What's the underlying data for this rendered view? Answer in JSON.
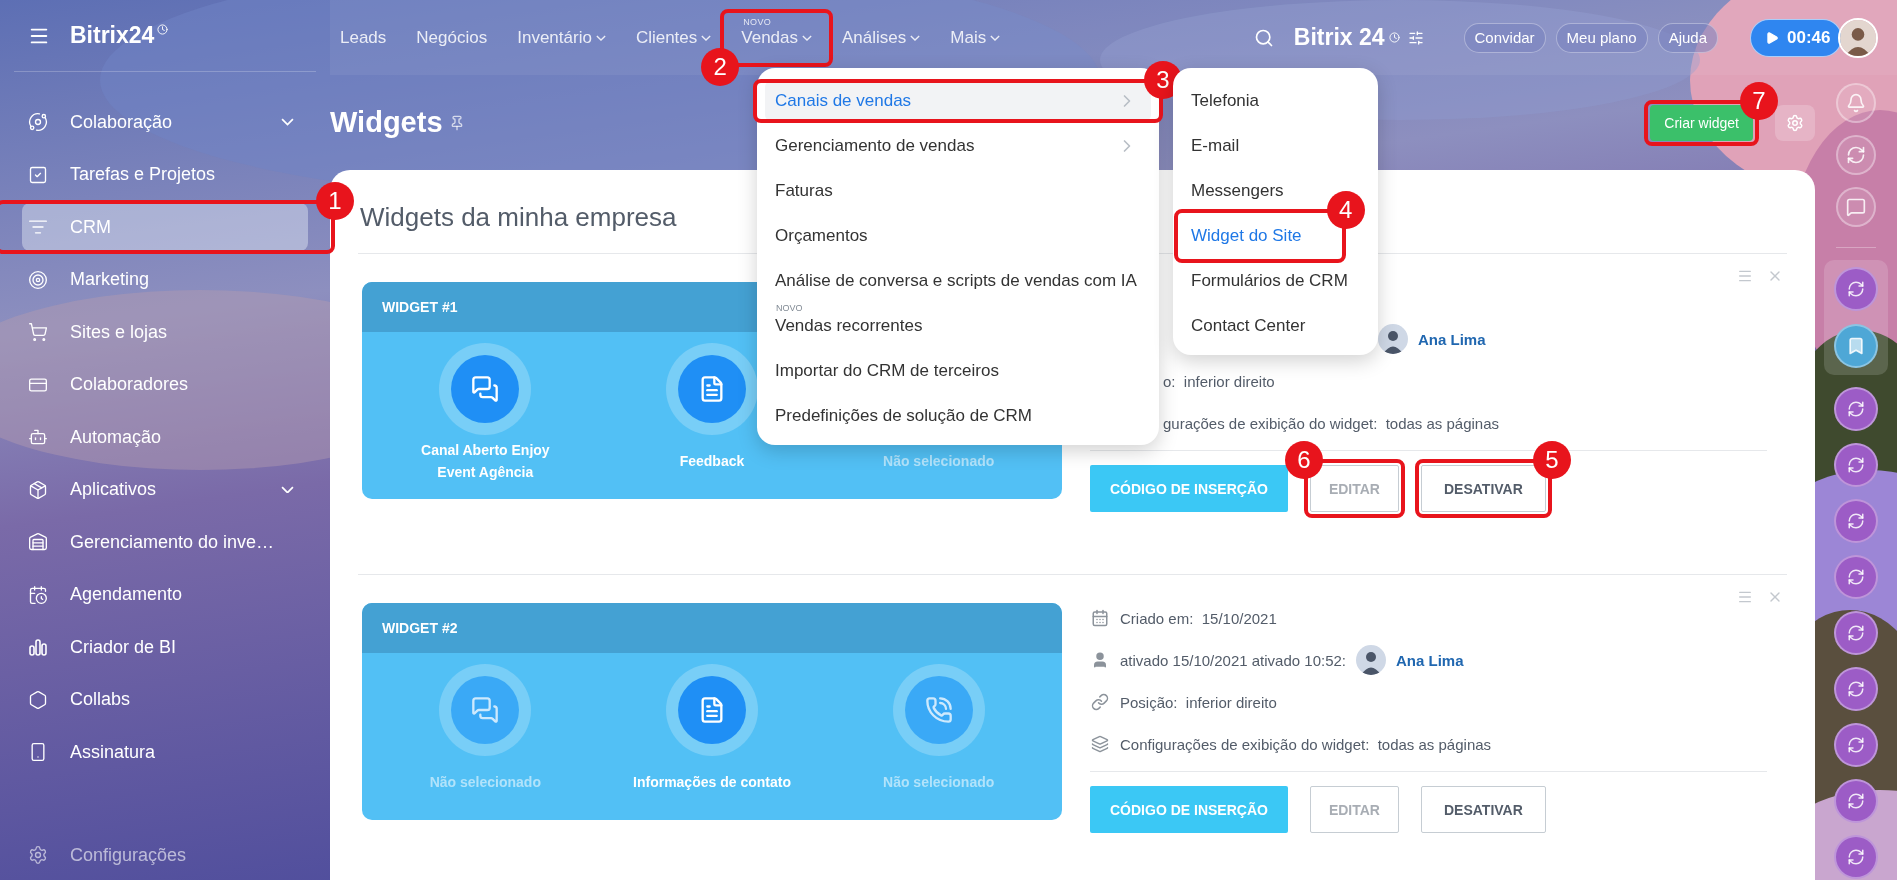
{
  "sidebar": {
    "logo": "Bitrix24",
    "items": [
      {
        "label": "Colaboração",
        "selected": false,
        "expandable": true
      },
      {
        "label": "Tarefas e Projetos",
        "selected": false,
        "expandable": false
      },
      {
        "label": "CRM",
        "selected": true,
        "expandable": false,
        "annotation": {
          "number": "1"
        }
      },
      {
        "label": "Marketing",
        "selected": false,
        "expandable": false
      },
      {
        "label": "Sites e lojas",
        "selected": false,
        "expandable": false
      },
      {
        "label": "Colaboradores",
        "selected": false,
        "expandable": false
      },
      {
        "label": "Automação",
        "selected": false,
        "expandable": false
      },
      {
        "label": "Aplicativos",
        "selected": false,
        "expandable": true
      },
      {
        "label": "Gerenciamento do inve…",
        "selected": false,
        "expandable": false
      },
      {
        "label": "Agendamento",
        "selected": false,
        "expandable": false
      },
      {
        "label": "Criador de BI",
        "selected": false,
        "expandable": false
      },
      {
        "label": "Collabs",
        "selected": false,
        "expandable": false
      },
      {
        "label": "Assinatura",
        "selected": false,
        "expandable": false
      }
    ],
    "footer": "Configurações"
  },
  "topbar": {
    "nav": [
      {
        "label": "Leads",
        "dropdown": false
      },
      {
        "label": "Negócios",
        "dropdown": false
      },
      {
        "label": "Inventário",
        "dropdown": true
      },
      {
        "label": "Clientes",
        "dropdown": true
      },
      {
        "label": "Vendas",
        "dropdown": true,
        "badge": "NOVO",
        "annotation": {
          "number": "2"
        }
      },
      {
        "label": "Análises",
        "dropdown": true
      },
      {
        "label": "Mais",
        "dropdown": true
      }
    ],
    "logo": "Bitrix 24",
    "buttons": [
      "Convidar",
      "Meu plano",
      "Ajuda"
    ],
    "timer": "00:46"
  },
  "page": {
    "title": "Widgets",
    "create_button": {
      "label": "Criar widget",
      "annotation": {
        "number": "7"
      }
    }
  },
  "card": {
    "title": "Widgets da minha empresa",
    "widgets": [
      {
        "header": "WIDGET #1",
        "under_menu": true,
        "items": [
          {
            "label": "Canal Aberto Enjoy Event Agência",
            "selected": true
          },
          {
            "label": "Feedback",
            "selected": true
          },
          {
            "label": "Não selecionado",
            "selected": false
          }
        ],
        "info": [
          {
            "person": "Ana Lima"
          },
          {
            "text": "o:  inferior direito"
          },
          {
            "text": "gurações de exibição do widget:  todas as páginas"
          }
        ],
        "buttons": [
          {
            "label": "CÓDIGO DE INSERÇÃO",
            "kind": "primary"
          },
          {
            "label": "EDITAR",
            "kind": "muted",
            "annotation": {
              "number": "6"
            }
          },
          {
            "label": "DESATIVAR",
            "kind": "outline",
            "annotation": {
              "number": "5"
            }
          }
        ]
      },
      {
        "header": "WIDGET #2",
        "under_menu": false,
        "items": [
          {
            "label": "Não selecionado",
            "selected": false
          },
          {
            "label": "Informações de contato",
            "selected": true
          },
          {
            "label": "Não selecionado",
            "selected": false
          }
        ],
        "info": [
          {
            "text": "Criado em:  15/10/2021"
          },
          {
            "text": "ativado 15/10/2021 ativado 10:52:",
            "person": "Ana Lima"
          },
          {
            "text": "Posição:  inferior direito"
          },
          {
            "text": "Configurações de exibição do widget:  todas as páginas"
          }
        ],
        "buttons": [
          {
            "label": "CÓDIGO DE INSERÇÃO",
            "kind": "primary"
          },
          {
            "label": "EDITAR",
            "kind": "muted"
          },
          {
            "label": "DESATIVAR",
            "kind": "outline"
          }
        ]
      }
    ]
  },
  "menu": {
    "items": [
      {
        "label": "Canais de vendas",
        "selected": true,
        "submenu": true,
        "annotation": {
          "number": "3"
        }
      },
      {
        "label": "Gerenciamento de vendas",
        "selected": false,
        "submenu": true
      },
      {
        "label": "Faturas",
        "selected": false,
        "submenu": false
      },
      {
        "label": "Orçamentos",
        "selected": false,
        "submenu": false
      },
      {
        "label": "Análise de conversa e scripts de vendas com IA",
        "selected": false,
        "submenu": false
      },
      {
        "label": "Vendas recorrentes",
        "selected": false,
        "submenu": false,
        "badge": "NOVO"
      },
      {
        "label": "Importar do CRM de terceiros",
        "selected": false,
        "submenu": false
      },
      {
        "label": "Predefinições de solução de CRM",
        "selected": false,
        "submenu": false
      }
    ]
  },
  "submenu": {
    "items": [
      {
        "label": "Telefonia",
        "selected": false
      },
      {
        "label": "E-mail",
        "selected": false
      },
      {
        "label": "Messengers",
        "selected": false
      },
      {
        "label": "Widget do Site",
        "selected": true,
        "annotation": {
          "number": "4"
        }
      },
      {
        "label": "Formulários de CRM",
        "selected": false
      },
      {
        "label": "Contact Center",
        "selected": false
      }
    ]
  },
  "right_rail": {
    "tools": [
      {
        "kind": "bell"
      },
      {
        "kind": "sync"
      },
      {
        "kind": "chat"
      }
    ],
    "pinned": [
      {
        "kind": "contact"
      },
      {
        "kind": "bookmark"
      }
    ],
    "contacts": [
      {
        "kind": "contact"
      },
      {
        "kind": "contact"
      },
      {
        "kind": "contact"
      },
      {
        "kind": "contact"
      },
      {
        "kind": "contact"
      },
      {
        "kind": "contact"
      },
      {
        "kind": "contact"
      },
      {
        "kind": "contact"
      },
      {
        "kind": "contact"
      }
    ]
  }
}
